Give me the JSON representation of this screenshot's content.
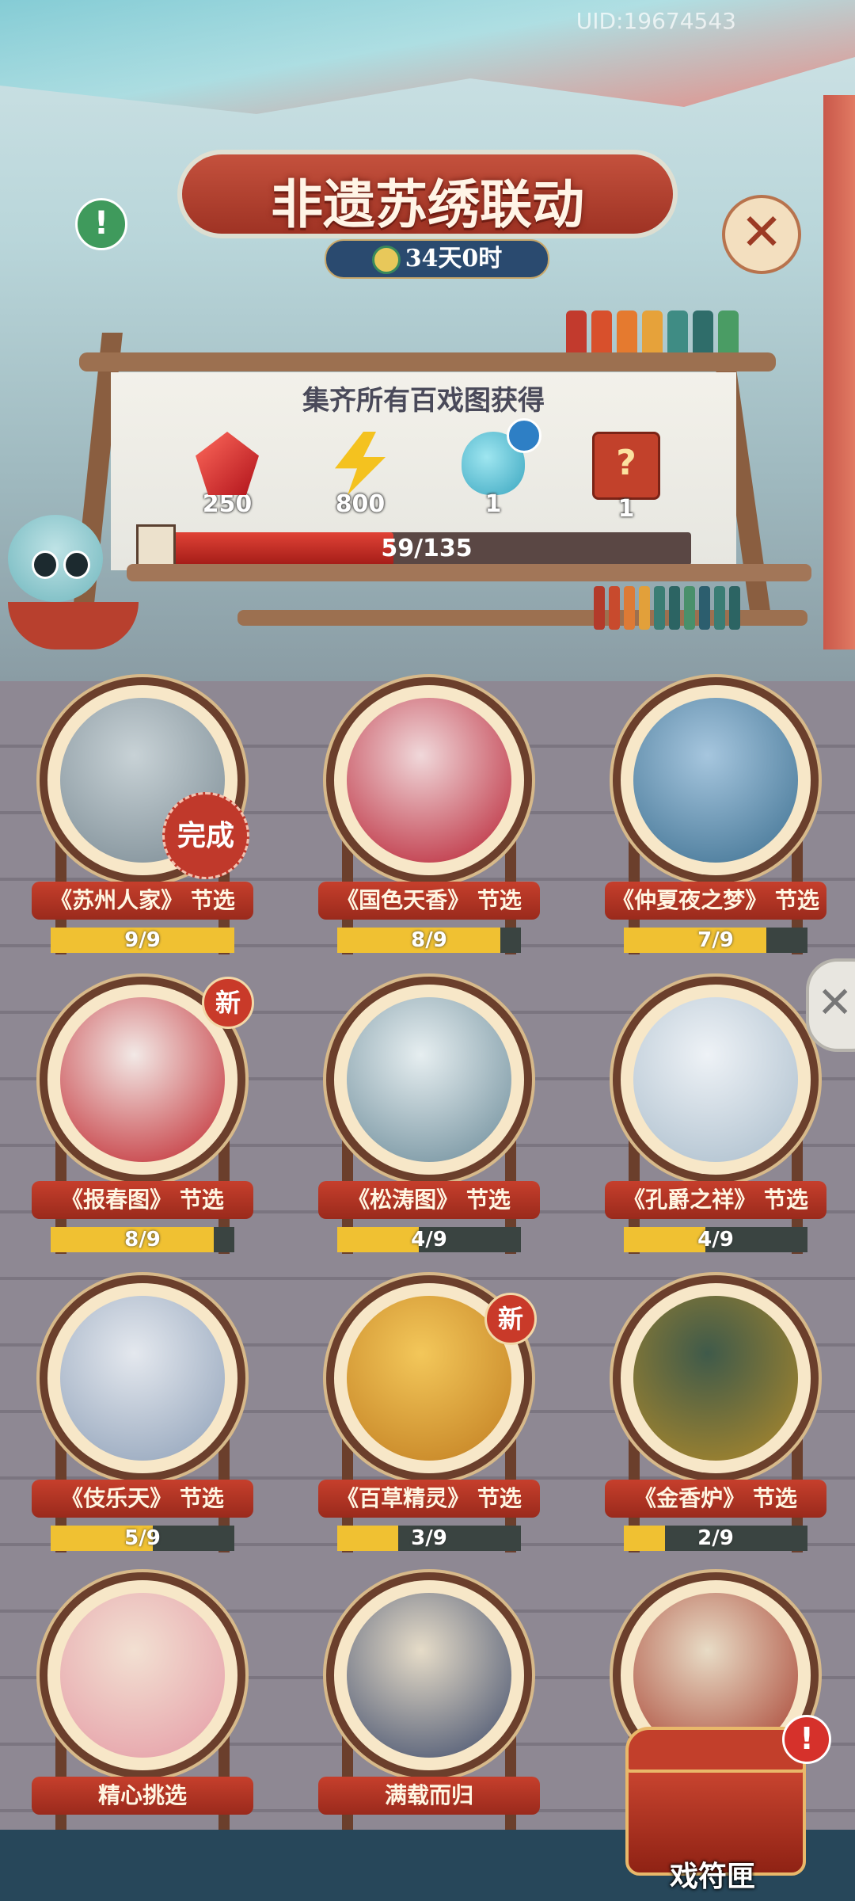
{
  "header": {
    "uid": "UID:19674543",
    "title": "非遗苏绣联动",
    "timer": "34天0时"
  },
  "rewards_panel": {
    "caption": "集齐所有百戏图获得",
    "rewards": [
      {
        "icon": "red-gem-icon",
        "count": "250"
      },
      {
        "icon": "lightning-icon",
        "count": "800"
      },
      {
        "icon": "gourd-icon",
        "count": "1"
      },
      {
        "icon": "mystery-chest-icon",
        "count": "1"
      }
    ],
    "progress_text": "59/135",
    "progress_fraction": 0.437
  },
  "cards": [
    {
      "label": "《苏州人家》 节选",
      "progress": "9/9",
      "fill": 1.0,
      "badge": "完成",
      "art_top": "#c8d2d6",
      "art_bottom": "#7a8a93"
    },
    {
      "label": "《国色天香》 节选",
      "progress": "8/9",
      "fill": 0.889,
      "badge": "",
      "art_top": "#f0d8da",
      "art_bottom": "#b81e30"
    },
    {
      "label": "《仲夏夜之梦》 节选",
      "progress": "7/9",
      "fill": 0.778,
      "badge": "",
      "art_top": "#a6c6de",
      "art_bottom": "#3c6f90"
    },
    {
      "label": "《报春图》 节选",
      "progress": "8/9",
      "fill": 0.889,
      "badge": "新",
      "art_top": "#f2e9e6",
      "art_bottom": "#c0242b"
    },
    {
      "label": "《松涛图》 节选",
      "progress": "4/9",
      "fill": 0.444,
      "badge": "",
      "art_top": "#e6eef0",
      "art_bottom": "#6a8a98"
    },
    {
      "label": "《孔爵之祥》 节选",
      "progress": "4/9",
      "fill": 0.444,
      "badge": "",
      "art_top": "#eef2f6",
      "art_bottom": "#a9bccb"
    },
    {
      "label": "《伎乐天》 节选",
      "progress": "5/9",
      "fill": 0.556,
      "badge": "",
      "art_top": "#e4e8ee",
      "art_bottom": "#8ea0b8"
    },
    {
      "label": "《百草精灵》 节选",
      "progress": "3/9",
      "fill": 0.333,
      "badge": "新",
      "art_top": "#f3c75a",
      "art_bottom": "#c17d20"
    },
    {
      "label": "《金香炉》 节选",
      "progress": "2/9",
      "fill": 0.222,
      "badge": "",
      "art_top": "#3f5a4a",
      "art_bottom": "#b08a2a"
    },
    {
      "label": "精心挑选",
      "progress": "",
      "fill": 0,
      "badge": "",
      "art_top": "#f2e0d2",
      "art_bottom": "#e59aa5"
    },
    {
      "label": "满载而归",
      "progress": "",
      "fill": 0,
      "badge": "",
      "art_top": "#e6dcc8",
      "art_bottom": "#3d4a6a"
    },
    {
      "label": "",
      "progress": "",
      "fill": 0,
      "badge": "",
      "art_top": "#e8dcc6",
      "art_bottom": "#a53a2a"
    }
  ],
  "chest": {
    "label": "戏符匣",
    "alert": "!"
  },
  "buttons": {
    "info": "!",
    "close": "✕",
    "side_tab": "✕"
  },
  "colors": {
    "accent_red": "#c63f2c",
    "progress_yellow": "#f0c132"
  }
}
